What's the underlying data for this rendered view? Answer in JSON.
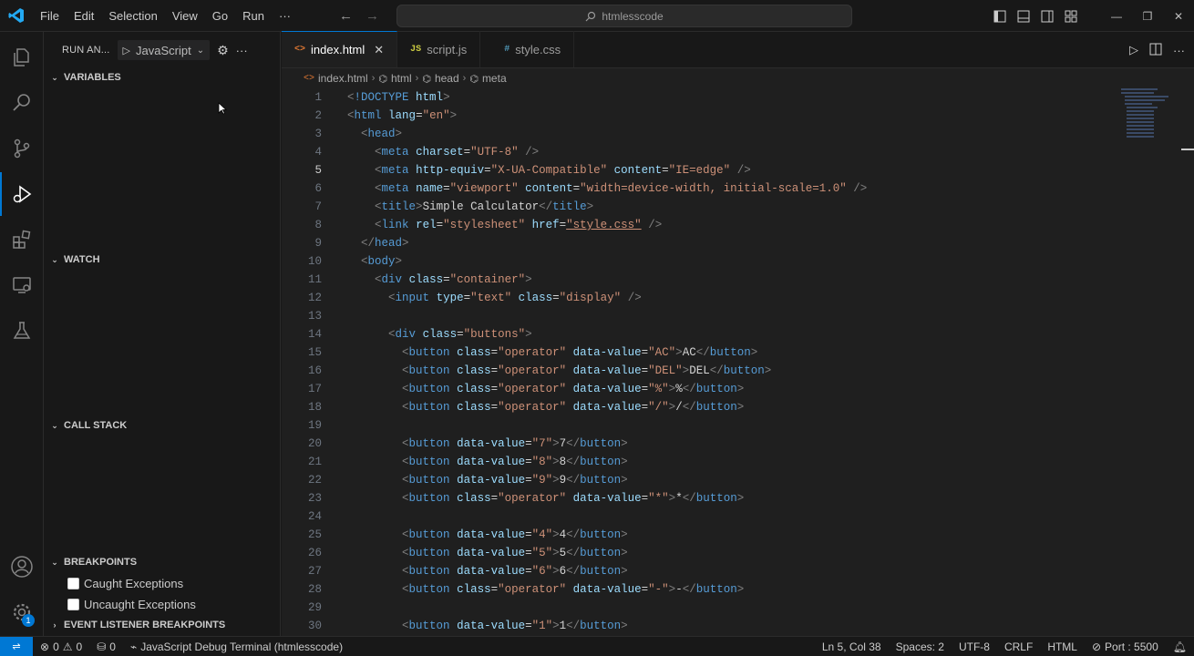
{
  "menu": [
    "File",
    "Edit",
    "Selection",
    "View",
    "Go",
    "Run",
    "···"
  ],
  "command_center": {
    "text": "htmlesscode"
  },
  "sidebar": {
    "run_title": "RUN AN...",
    "run_config": "JavaScript",
    "sections": {
      "variables": "VARIABLES",
      "watch": "WATCH",
      "call_stack": "CALL STACK",
      "breakpoints": "BREAKPOINTS",
      "event_listener_breakpoints": "EVENT LISTENER BREAKPOINTS"
    },
    "breakpoint_items": [
      "Caught Exceptions",
      "Uncaught Exceptions"
    ]
  },
  "tabs": [
    {
      "icon": "<>",
      "label": "index.html",
      "active": true
    },
    {
      "icon": "JS",
      "label": "script.js",
      "active": false
    },
    {
      "icon": "#",
      "label": "style.css",
      "active": false
    }
  ],
  "breadcrumb": [
    "index.html",
    "html",
    "head",
    "meta"
  ],
  "code": {
    "current_line": 5,
    "lines": [
      "<!DOCTYPE html>",
      "<html lang=\"en\">",
      "  <head>",
      "    <meta charset=\"UTF-8\" />",
      "    <meta http-equiv=\"X-UA-Compatible\" content=\"IE=edge\" />",
      "    <meta name=\"viewport\" content=\"width=device-width, initial-scale=1.0\" />",
      "    <title>Simple Calculator</title>",
      "    <link rel=\"stylesheet\" href=\"style.css\" />",
      "  </head>",
      "  <body>",
      "    <div class=\"container\">",
      "      <input type=\"text\" class=\"display\" />",
      "",
      "      <div class=\"buttons\">",
      "        <button class=\"operator\" data-value=\"AC\">AC</button>",
      "        <button class=\"operator\" data-value=\"DEL\">DEL</button>",
      "        <button class=\"operator\" data-value=\"%\">%</button>",
      "        <button class=\"operator\" data-value=\"/\">/</button>",
      "",
      "        <button data-value=\"7\">7</button>",
      "        <button data-value=\"8\">8</button>",
      "        <button data-value=\"9\">9</button>",
      "        <button class=\"operator\" data-value=\"*\">*</button>",
      "",
      "        <button data-value=\"4\">4</button>",
      "        <button data-value=\"5\">5</button>",
      "        <button data-value=\"6\">6</button>",
      "        <button class=\"operator\" data-value=\"-\">-</button>",
      "",
      "        <button data-value=\"1\">1</button>"
    ]
  },
  "statusbar": {
    "errors": "0",
    "warnings": "0",
    "ports": "0",
    "debug_terminal": "JavaScript Debug Terminal (htmlesscode)",
    "position": "Ln 5, Col 38",
    "spaces": "Spaces: 2",
    "encoding": "UTF-8",
    "eol": "CRLF",
    "language": "HTML",
    "port": "Port : 5500"
  },
  "colors": {
    "accent": "#0078d4",
    "tag": "#569cd6",
    "attr": "#9cdcfe",
    "string": "#ce9178"
  }
}
